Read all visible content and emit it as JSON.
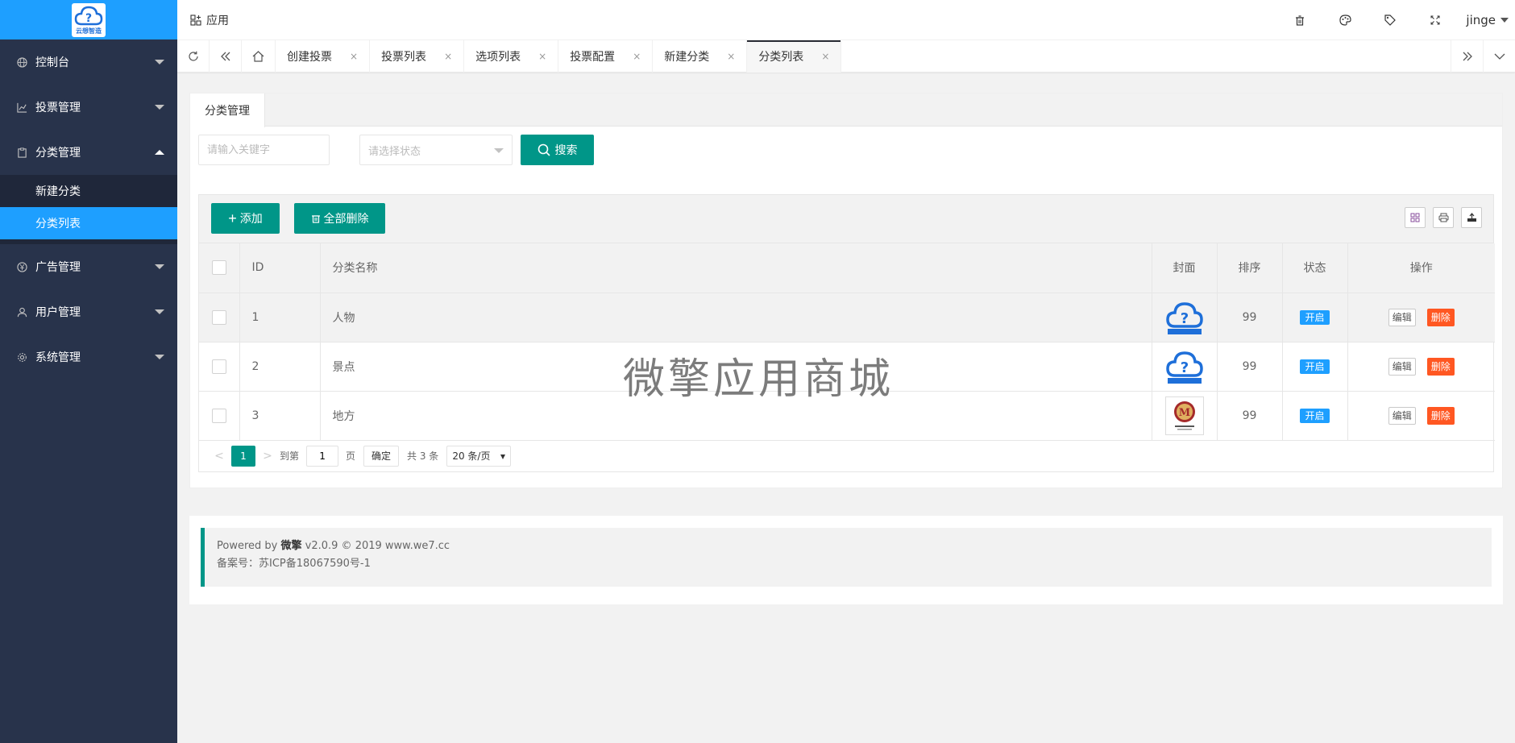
{
  "logo": {
    "text": "云想智造"
  },
  "sidebar": {
    "items": [
      {
        "label": "控制台",
        "icon": "globe-icon",
        "expanded": false
      },
      {
        "label": "投票管理",
        "icon": "chart-icon",
        "expanded": false
      },
      {
        "label": "分类管理",
        "icon": "clipboard-icon",
        "expanded": true,
        "children": [
          {
            "label": "新建分类",
            "active": false
          },
          {
            "label": "分类列表",
            "active": true
          }
        ]
      },
      {
        "label": "广告管理",
        "icon": "yen-icon",
        "expanded": false
      },
      {
        "label": "用户管理",
        "icon": "user-icon",
        "expanded": false
      },
      {
        "label": "系统管理",
        "icon": "gear-icon",
        "expanded": false
      }
    ]
  },
  "header": {
    "app_label": "应用",
    "user": "jinge",
    "icons": [
      "trash-icon",
      "palette-icon",
      "tag-icon",
      "fullscreen-icon"
    ]
  },
  "tabs": [
    {
      "label": "创建投票",
      "active": false
    },
    {
      "label": "投票列表",
      "active": false
    },
    {
      "label": "选项列表",
      "active": false
    },
    {
      "label": "投票配置",
      "active": false
    },
    {
      "label": "新建分类",
      "active": false
    },
    {
      "label": "分类列表",
      "active": true
    }
  ],
  "close_glyph": "×",
  "card": {
    "tab_label": "分类管理",
    "search": {
      "keyword_placeholder": "请输入关键字",
      "status_placeholder": "请选择状态",
      "button_label": "搜索"
    },
    "toolbar": {
      "add_label": "添加",
      "delete_all_label": "全部删除"
    },
    "table": {
      "headers": [
        "ID",
        "分类名称",
        "封面",
        "排序",
        "状态",
        "操作"
      ],
      "rows": [
        {
          "id": "1",
          "name": "人物",
          "cover": "cloud-logo",
          "sort": "99",
          "status": "开启"
        },
        {
          "id": "2",
          "name": "景点",
          "cover": "cloud-logo",
          "sort": "99",
          "status": "开启"
        },
        {
          "id": "3",
          "name": "地方",
          "cover": "badge-logo",
          "sort": "99",
          "status": "开启"
        }
      ],
      "edit_label": "编辑",
      "delete_label": "删除"
    },
    "pager": {
      "current": "1",
      "goto_label": "到第",
      "goto_value": "1",
      "page_unit": "页",
      "confirm_label": "确定",
      "total_label": "共 3 条",
      "page_size": "20 条/页"
    }
  },
  "watermark": "微擎应用商城",
  "footer": {
    "powered_prefix": "Powered by",
    "powered_brand": "微擎",
    "powered_suffix": "v2.0.9 © 2019 www.we7.cc",
    "icp": "备案号：苏ICP备18067590号-1"
  },
  "colors": {
    "primary": "#009688",
    "accent": "#1e9fff",
    "sidebar_bg": "#28334b",
    "danger": "#ff5722"
  }
}
